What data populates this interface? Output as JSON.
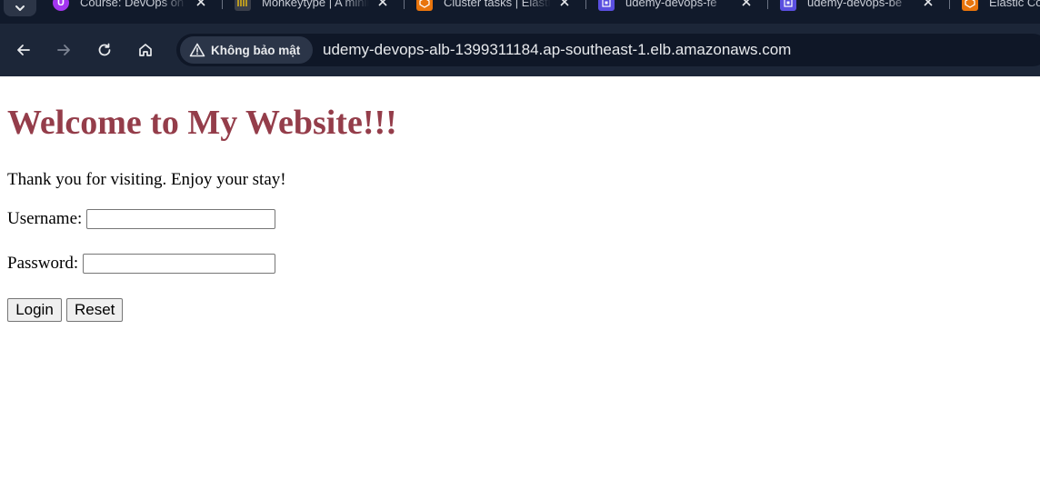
{
  "browser": {
    "tabs": [
      {
        "title": "Course: DevOps on AWS",
        "icon": "udemy-icon",
        "icon_color": "#a435f0"
      },
      {
        "title": "Monkeytype | A minimalistic typing test",
        "icon": "monkeytype-icon",
        "icon_color": "#3a3f4a"
      },
      {
        "title": "Cluster tasks | Elastic Container Service",
        "icon": "aws-ecs-icon",
        "icon_color": "#e8740c"
      },
      {
        "title": "udemy-devops-fe",
        "icon": "aws-ec2-icon",
        "icon_color": "#5a4fe0"
      },
      {
        "title": "udemy-devops-be",
        "icon": "aws-ec2-icon",
        "icon_color": "#5a4fe0"
      },
      {
        "title": "Elastic Container Service",
        "icon": "aws-ecs-icon",
        "icon_color": "#e8740c"
      }
    ],
    "security_label": "Không bảo mật",
    "url": "udemy-devops-alb-1399311184.ap-southeast-1.elb.amazonaws.com",
    "colors": {
      "tabstrip": "#111a2b",
      "toolbar": "#1c2638",
      "omnibox": "#0f1727"
    }
  },
  "page": {
    "heading": "Welcome to My Website!!!",
    "intro": "Thank you for visiting. Enjoy your stay!",
    "username_label": "Username:",
    "username_value": "",
    "password_label": "Password:",
    "password_value": "",
    "login_button": "Login",
    "reset_button": "Reset",
    "heading_color": "#943d4a"
  }
}
